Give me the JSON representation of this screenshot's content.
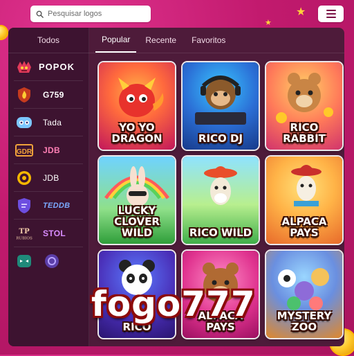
{
  "search": {
    "placeholder": "Pesquisar logos"
  },
  "sidebar": {
    "header": "Todos",
    "providers": [
      {
        "label": "POPOK",
        "icon": "dragon-icon"
      },
      {
        "label": "G759",
        "icon": "flame-shield-icon"
      },
      {
        "label": "Tada",
        "icon": "tada-mascot-icon"
      },
      {
        "label": "JDB",
        "icon": "gdr-logo-icon"
      },
      {
        "label": "JDB",
        "icon": "gold-coin-icon"
      },
      {
        "label": "TEDDB",
        "icon": "purple-shield-icon"
      },
      {
        "label": "STOL",
        "icon": "tp-rubios-icon"
      },
      {
        "label": "",
        "icon": "green-mask-icon"
      }
    ]
  },
  "tabs": [
    {
      "label": "Popular",
      "active": true
    },
    {
      "label": "Recente",
      "active": false
    },
    {
      "label": "Favoritos",
      "active": false
    }
  ],
  "games": [
    {
      "title": "Yo Yo Dragon"
    },
    {
      "title": "Rico DJ"
    },
    {
      "title": "Rico Rabbit"
    },
    {
      "title": "Lucky Clover Wild"
    },
    {
      "title": "Rico Wild"
    },
    {
      "title": "Alpaca Pays"
    },
    {
      "title": "Rico"
    },
    {
      "title": "Alpaca Pays"
    },
    {
      "title": "Mystery Zoo"
    }
  ],
  "watermark": "fogo777",
  "colors": {
    "brand": "#c21a6e",
    "panel": "#4e1b3a",
    "sidebar": "#3d1330",
    "gold": "#ffc929"
  }
}
